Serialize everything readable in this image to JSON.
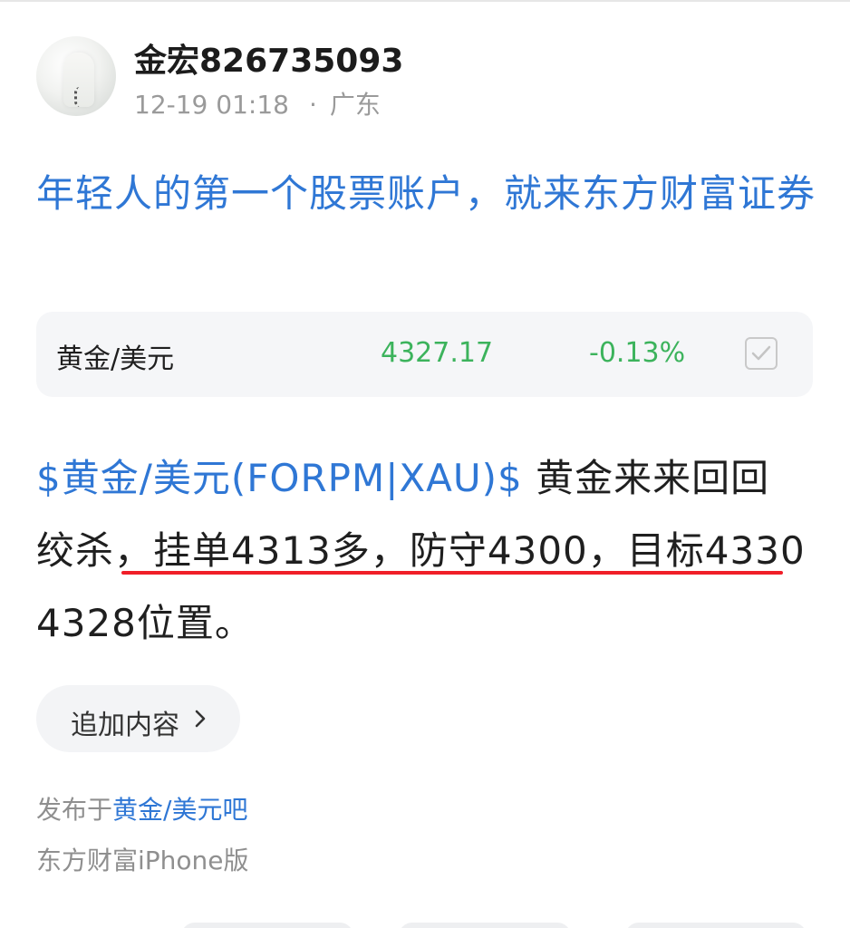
{
  "author": {
    "name": "金宏826735093",
    "time": "12-19 01:18",
    "separator": "·",
    "location": "广东"
  },
  "promo": {
    "text": "年轻人的第一个股票账户，就来东方财富证券"
  },
  "quote_card": {
    "name": "黄金/美元",
    "price": "4327.17",
    "change": "-0.13%",
    "price_color": "#3cb35c",
    "icon": "checkbox-icon"
  },
  "post": {
    "tag": "$黄金/美元(FORPM|XAU)$",
    "line1_rest": " 黄金来来回回",
    "line2": "绞杀，挂单4313多，防守4300，目标4330",
    "line3": " 4328位置。",
    "highlight_color": "#f01e28"
  },
  "actions": {
    "add_content_label": "追加内容",
    "add_content_icon": "chevron-right-icon"
  },
  "footer": {
    "posted_in_prefix": "发布于",
    "forum_link": "黄金/美元吧",
    "client": "东方财富iPhone版"
  },
  "colors": {
    "link": "#2f77d5",
    "muted": "#8f8f8f"
  }
}
